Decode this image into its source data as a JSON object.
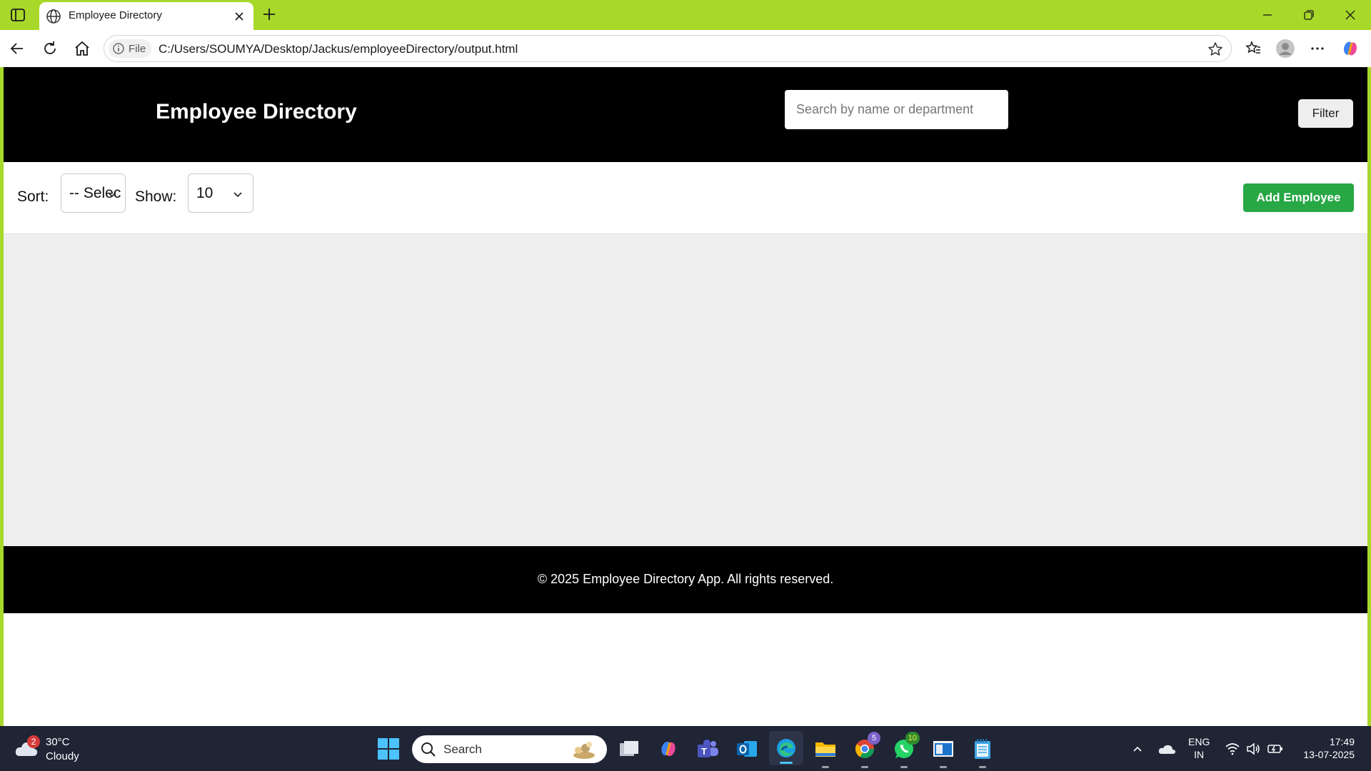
{
  "browser": {
    "tab_title": "Employee Directory",
    "file_label": "File",
    "url": "C:/Users/SOUMYA/Desktop/Jackus/employeeDirectory/output.html"
  },
  "header": {
    "title": "Employee Directory",
    "search_placeholder": "Search by name or department",
    "filter_label": "Filter"
  },
  "controls": {
    "sort_label": "Sort:",
    "sort_value": "-- Selec",
    "show_label": "Show:",
    "show_value": "10",
    "add_label": "Add Employee"
  },
  "footer": {
    "text": "© 2025 Employee Directory App. All rights reserved."
  },
  "taskbar": {
    "weather_temp": "30°C",
    "weather_desc": "Cloudy",
    "weather_badge": "2",
    "search_label": "Search",
    "chrome_badge": "5",
    "whatsapp_badge": "10",
    "lang_line1": "ENG",
    "lang_line2": "IN",
    "time": "17:49",
    "date": "13-07-2025"
  },
  "colors": {
    "titlebar": "#a8d829",
    "header_bg": "#000000",
    "add_button": "#28a745",
    "content_bg": "#eeeeee",
    "taskbar_bg": "#1f2535"
  }
}
